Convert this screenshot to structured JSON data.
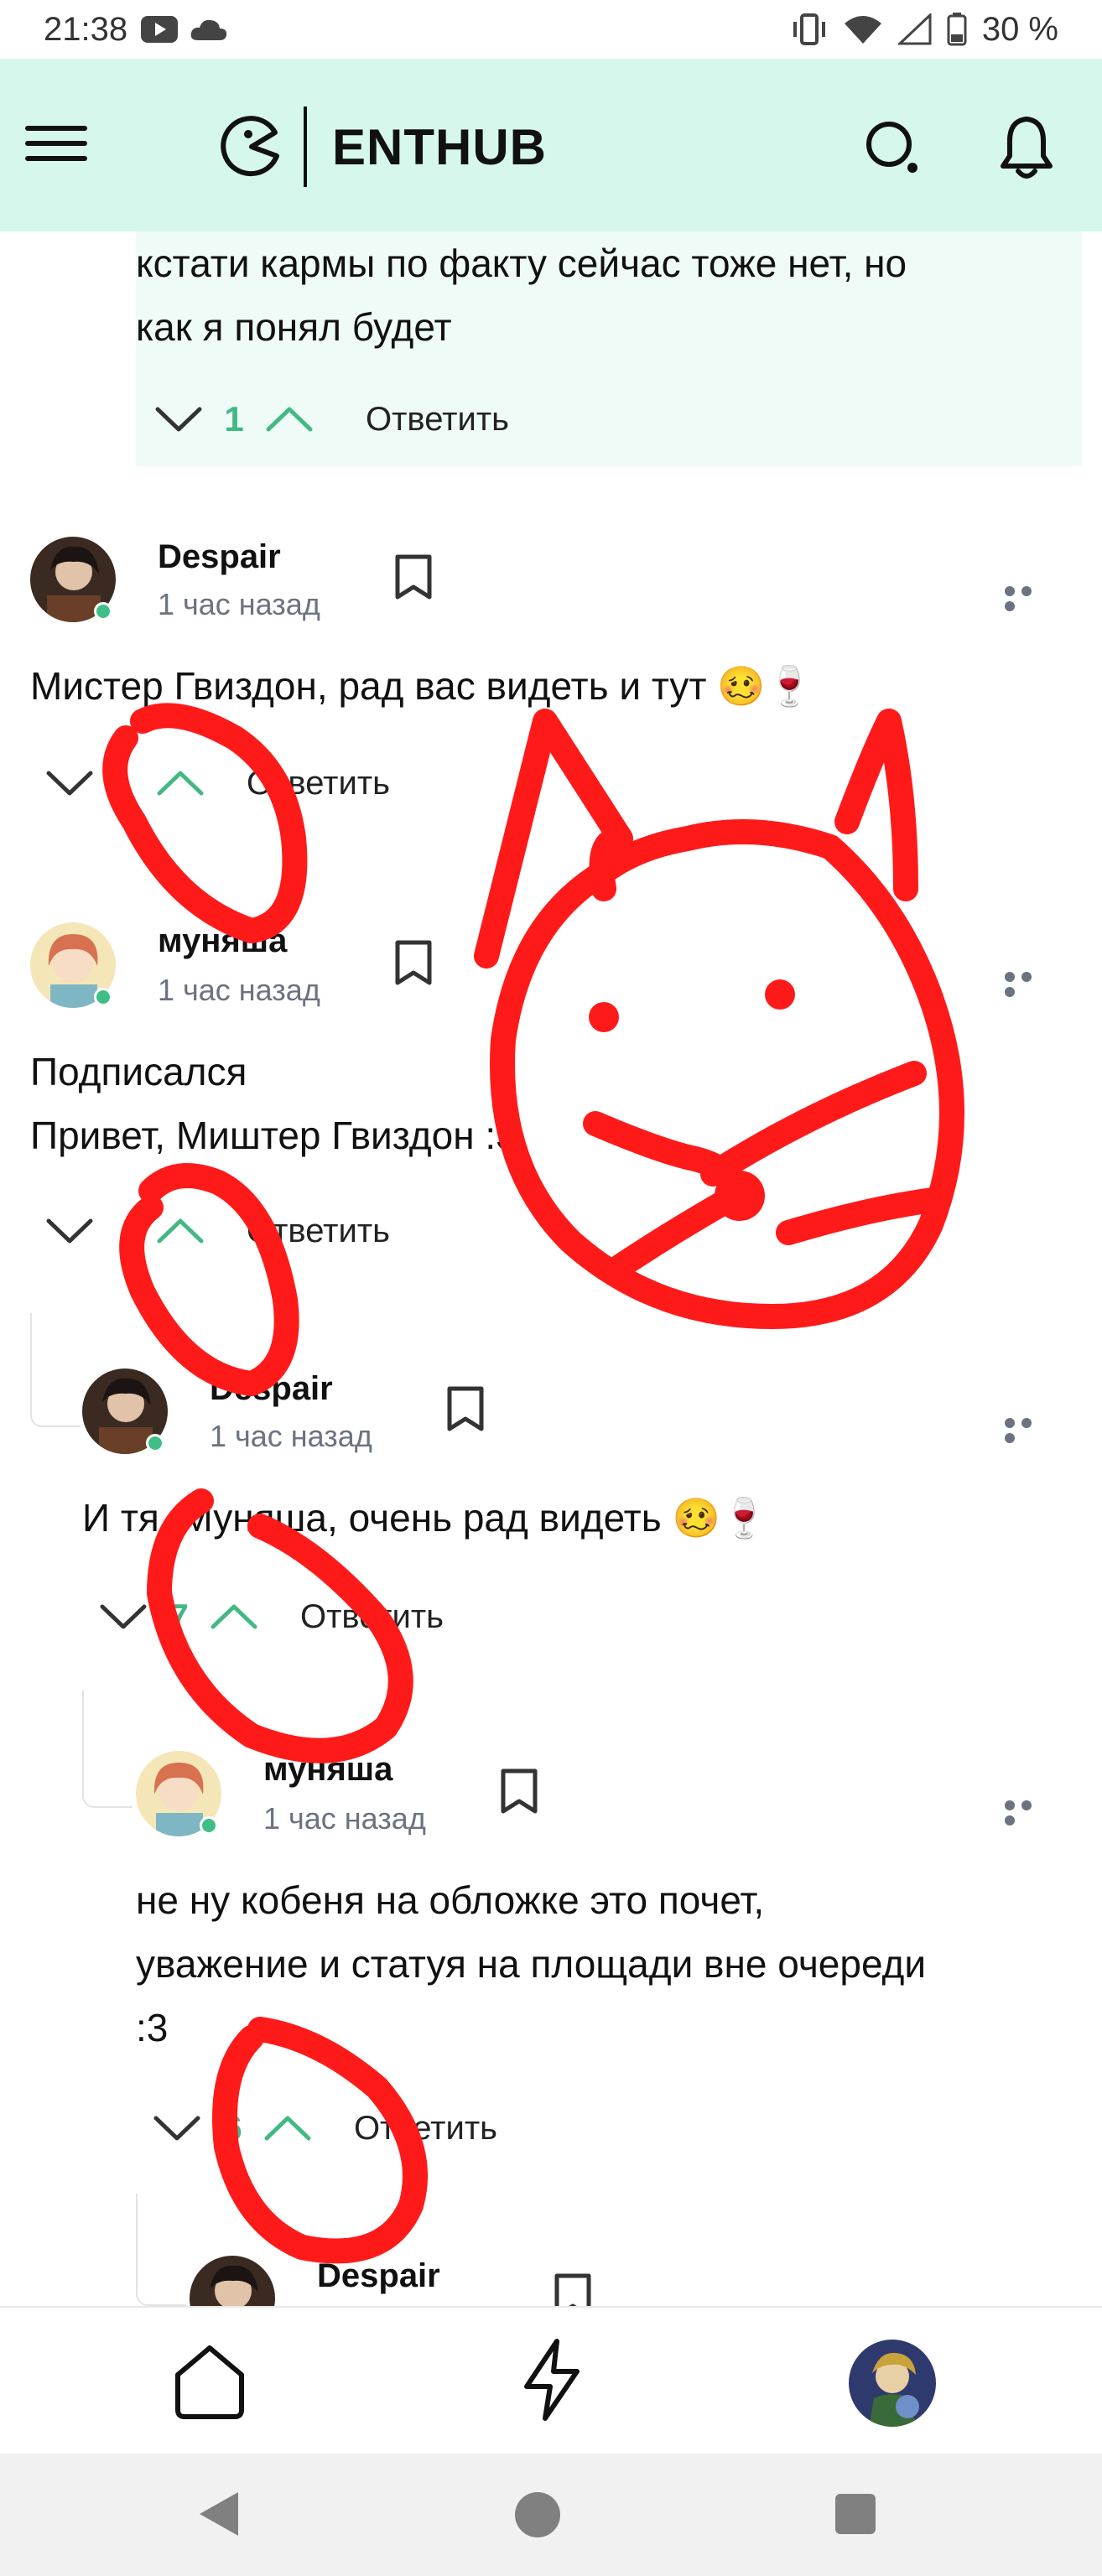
{
  "status_bar": {
    "time": "21:38",
    "battery": "30 %"
  },
  "header": {
    "logo_text": "ENTHUB"
  },
  "previous_comment": {
    "lines": [
      "кстати кармы по факту сейчас тоже нет, но",
      "как я понял будет"
    ],
    "score": "1",
    "reply_label": "Ответить"
  },
  "comments": [
    {
      "author": "Despair",
      "time": "1 час назад",
      "lines": [
        "Мистер Гвиздон, рад вас видеть и тут 🥴🍷"
      ],
      "score": "",
      "reply_label": "Ответить"
    },
    {
      "author": "муняша",
      "time": "1 час назад",
      "lines": [
        "Подписался",
        "Привет, Миштер Гвиздон :3"
      ],
      "score": "",
      "reply_label": "Ответить"
    },
    {
      "author": "Despair",
      "time": "1 час назад",
      "lines": [
        "И тя, Муняша, очень рад видеть 🥴🍷"
      ],
      "score": "7",
      "reply_label": "Ответить"
    },
    {
      "author": "муняша",
      "time": "1 час назад",
      "lines": [
        "не ну кобеня на обложке это почет,",
        "уважение и статуя на площади вне очереди",
        ":3"
      ],
      "score": "6",
      "reply_label": "Ответить"
    },
    {
      "author": "Despair",
      "time": "",
      "lines": [],
      "score": "",
      "reply_label": ""
    }
  ],
  "colors": {
    "accent": "#43b883",
    "header_bg": "#d6f7ec",
    "online": "#3fbf86",
    "annotation": "#ff1a1a"
  }
}
